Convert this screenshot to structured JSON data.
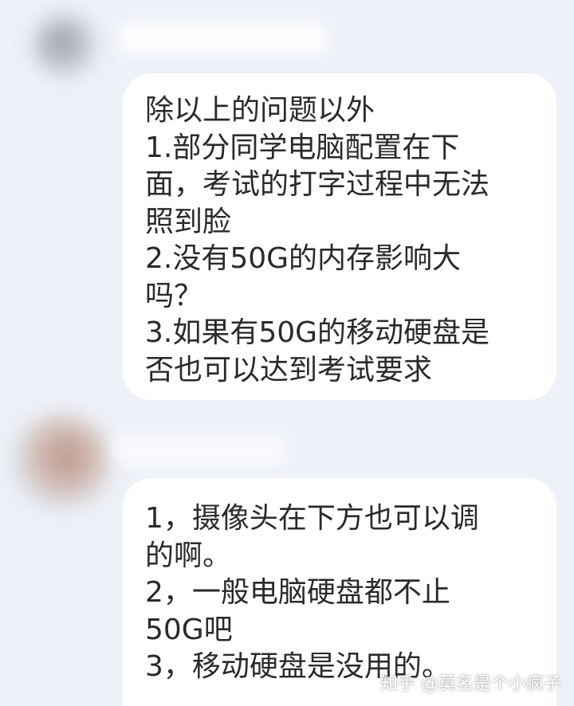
{
  "messages": [
    {
      "lines": [
        "除以上的问题以外",
        "1.部分同学电脑配置在下",
        "面，考试的打字过程中无法",
        "照到脸",
        "2.没有50G的内存影响大",
        "吗？",
        "3.如果有50G的移动硬盘是",
        "否也可以达到考试要求"
      ]
    },
    {
      "lines": [
        "1，摄像头在下方也可以调",
        "的啊。",
        "2，一般电脑硬盘都不止",
        "50G吧",
        "3，移动硬盘是没用的。"
      ]
    }
  ],
  "watermark": "知乎 @莫名是个小疯子",
  "colors": {
    "background": "#eef1f8",
    "bubble": "#ffffff",
    "text": "#2a2a2a"
  }
}
